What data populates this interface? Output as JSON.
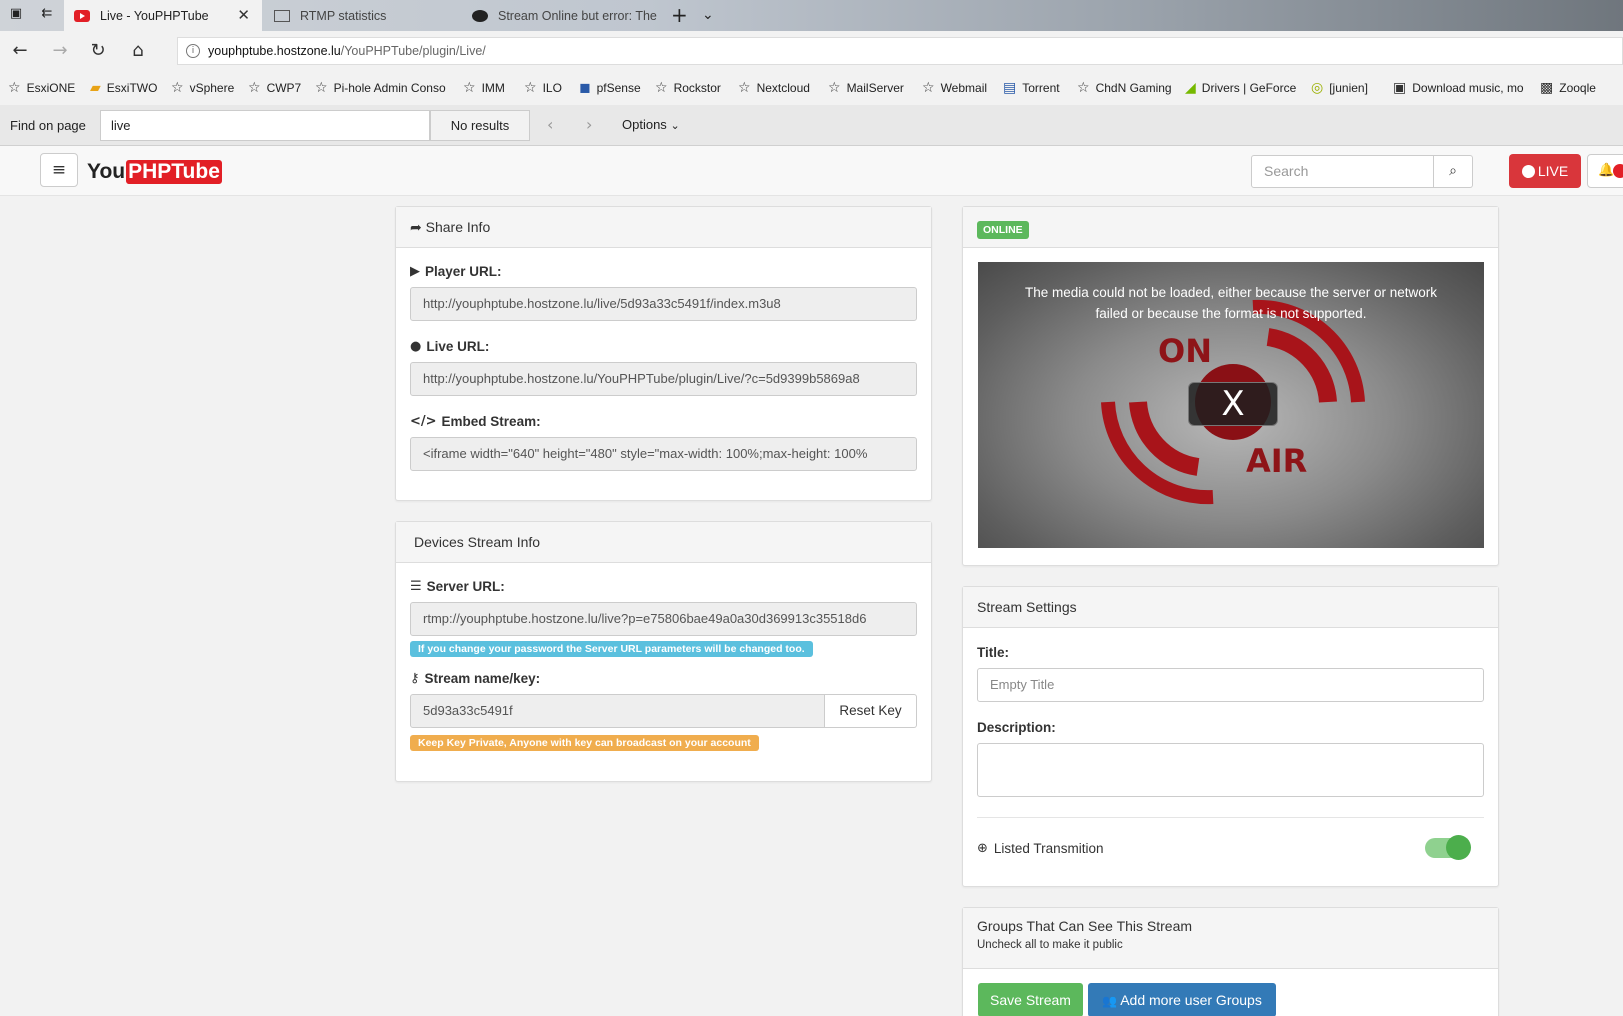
{
  "browser": {
    "tabs": [
      {
        "label": "Live - YouPHPTube",
        "active": true
      },
      {
        "label": "RTMP statistics",
        "active": false
      },
      {
        "label": "Stream Online but error: The",
        "active": false
      }
    ],
    "url_host": "youphptube.hostzone.lu",
    "url_path": "/YouPHPTube/plugin/Live/",
    "bookmarks": [
      "EsxiONE",
      "EsxiTWO",
      "vSphere",
      "CWP7",
      "Pi-hole Admin Conso",
      "IMM",
      "ILO",
      "pfSense",
      "Rockstor",
      "Nextcloud",
      "MailServer",
      "Webmail",
      "Torrent",
      "ChdN Gaming",
      "Drivers | GeForce",
      "[junien]",
      "Download music, mo",
      "Zooqle"
    ],
    "find": {
      "label": "Find on page",
      "query": "live",
      "results": "No results",
      "options": "Options"
    }
  },
  "header": {
    "search_placeholder": "Search",
    "live_label": "LIVE"
  },
  "share_info": {
    "title": "Share Info",
    "player_url_label": "Player URL:",
    "player_url": "http://youphptube.hostzone.lu/live/5d93a33c5491f/index.m3u8",
    "live_url_label": "Live URL:",
    "live_url": "http://youphptube.hostzone.lu/YouPHPTube/plugin/Live/?c=5d9399b5869a8",
    "embed_label": "Embed Stream:",
    "embed_code": "<iframe width=\"640\" height=\"480\" style=\"max-width: 100%;max-height: 100%"
  },
  "devices": {
    "title": "Devices Stream Info",
    "server_label": "Server URL:",
    "server_url": "rtmp://youphptube.hostzone.lu/live?p=e75806bae49a0a30d369913c35518d6",
    "server_note": "If you change your password the Server URL parameters will be changed too.",
    "key_label": "Stream name/key:",
    "key_value": "5d93a33c5491f",
    "reset_label": "Reset Key",
    "key_note": "Keep Key Private, Anyone with key can broadcast on your account"
  },
  "player": {
    "status": "ONLINE",
    "error_line1": "The media could not be loaded, either because the server or network",
    "error_line2": "failed or because the format is not supported.",
    "word_on": "ON",
    "word_air": "AIR",
    "close_label": "X"
  },
  "settings": {
    "title": "Stream Settings",
    "title_label": "Title:",
    "title_placeholder": "Empty Title",
    "description_label": "Description:",
    "listed_label": "Listed Transmition",
    "listed_on": true
  },
  "groups": {
    "title": "Groups That Can See This Stream",
    "subtitle": "Uncheck all to make it public",
    "save_label": "Save Stream",
    "add_label": "Add more user Groups"
  },
  "colors": {
    "brand_red": "#e21f26",
    "live_red": "#d9363b",
    "success": "#5cb85c",
    "primary": "#337ab7"
  }
}
